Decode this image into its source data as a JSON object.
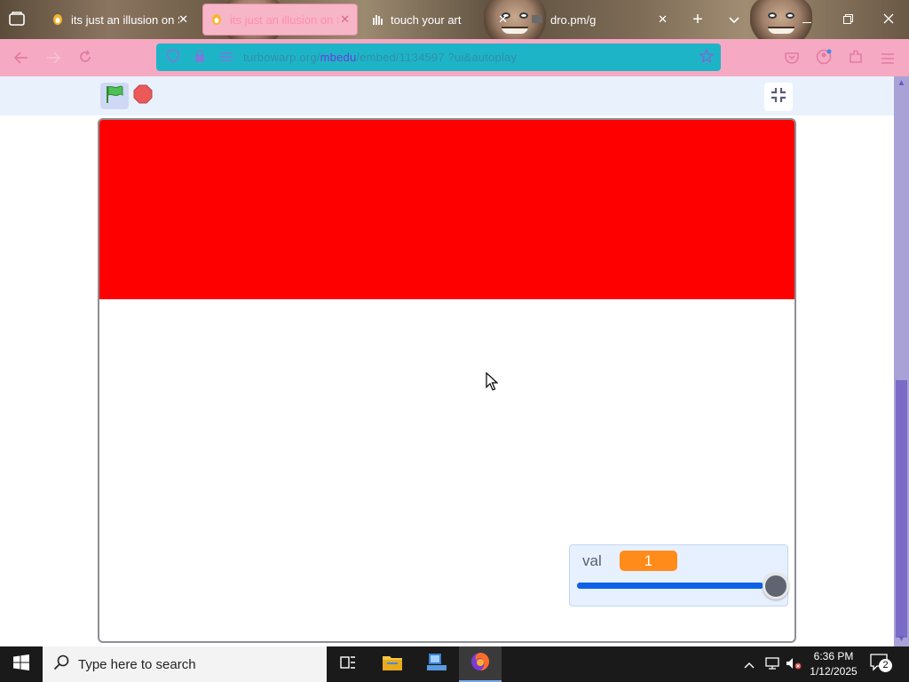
{
  "browser": {
    "tabs": [
      {
        "title": "its just an illusion on S",
        "favicon": "scratch-cat-icon",
        "active": false
      },
      {
        "title": "its just an illusion on S",
        "favicon": "scratch-cat-icon",
        "active": true
      },
      {
        "title": "touch your art",
        "favicon": "hand-icon",
        "active": false
      },
      {
        "title": "dro.pm/g",
        "favicon": "drop-icon",
        "active": false
      }
    ],
    "tab_close": "✕",
    "new_tab": "+",
    "url": {
      "prefix": "turbowarp.org/",
      "host": "mbedu",
      "rest": "/embed/1134597 ?ui&autoplay"
    }
  },
  "player": {
    "monitor": {
      "label": "val",
      "value": "1",
      "slider_fraction": 1.0
    }
  },
  "taskbar": {
    "search_placeholder": "Type here to search",
    "time": "6:36 PM",
    "date": "1/12/2025",
    "notification_count": "2"
  },
  "colors": {
    "sprite_red": "#ff0000",
    "monitor_orange": "#ff8c1a",
    "slider_blue": "#0f62e8",
    "tab_active": "#f7b6c7",
    "toolbar_pink": "#f6a9c2",
    "urlbar_teal": "#1eb4c8"
  }
}
